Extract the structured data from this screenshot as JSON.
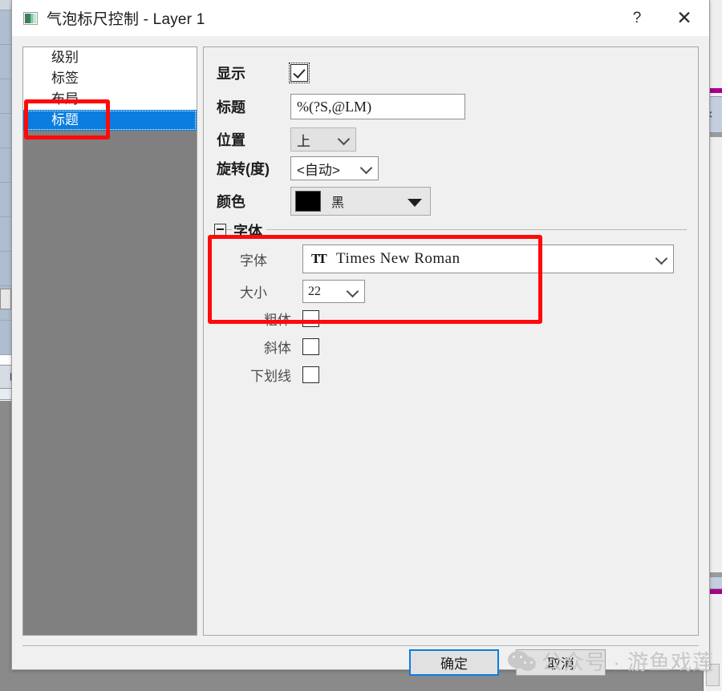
{
  "window": {
    "title": "气泡标尺控制 - Layer 1",
    "icon": "layer-color-icon",
    "help_label": "?",
    "close_label": "✕"
  },
  "sidebar": {
    "items": [
      {
        "label": "级别",
        "selected": false
      },
      {
        "label": "标签",
        "selected": false
      },
      {
        "label": "布局",
        "selected": false
      },
      {
        "label": "标题",
        "selected": true
      }
    ]
  },
  "form": {
    "show": {
      "label": "显示",
      "checked": true
    },
    "title": {
      "label": "标题",
      "value": "%(?S,@LM)"
    },
    "position": {
      "label": "位置",
      "value": "上"
    },
    "rotation": {
      "label": "旋转(度)",
      "value": "<自动>"
    },
    "color": {
      "label": "颜色",
      "value": "黑",
      "swatch": "#000000"
    }
  },
  "font_group": {
    "label": "字体",
    "expanded": true,
    "font": {
      "label": "字体",
      "value": "Times New Roman",
      "icon": "truetype-icon"
    },
    "size": {
      "label": "大小",
      "value": "22"
    },
    "bold": {
      "label": "粗体",
      "checked": false
    },
    "italic": {
      "label": "斜体",
      "checked": false
    },
    "underline": {
      "label": "下划线",
      "checked": false
    }
  },
  "footer": {
    "ok_label": "确定",
    "cancel_label": "取消"
  },
  "watermark": {
    "text": "公众号 · 游鱼戏莲",
    "logo": "wechat-icon"
  },
  "colors": {
    "accent_blue": "#0a7ddf",
    "annotation_red": "#ff0a0a",
    "panel_gray": "#808080",
    "background_magenta": "#a6008a"
  }
}
